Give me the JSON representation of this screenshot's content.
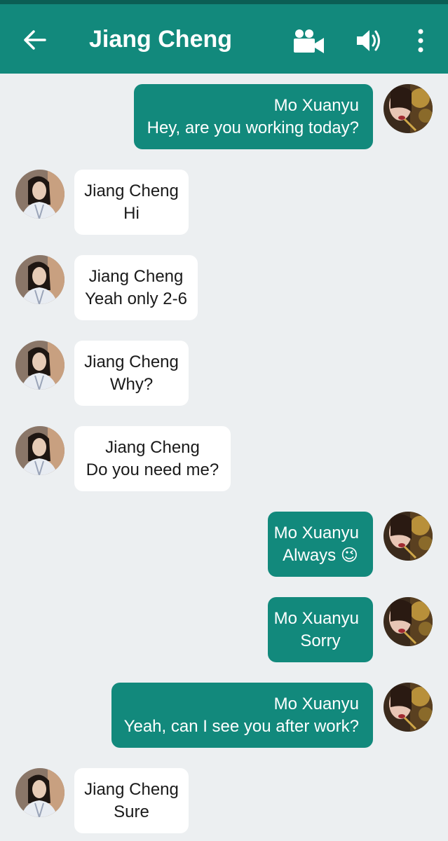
{
  "header": {
    "title": "Jiang Cheng",
    "back_icon": "arrow-left-icon",
    "video_icon": "video-camera-icon",
    "audio_icon": "speaker-icon",
    "more_icon": "more-vert-icon",
    "color": "#12897c"
  },
  "messages": [
    {
      "direction": "out",
      "sender": "Mo Xuanyu",
      "text": "Hey, are you working today?"
    },
    {
      "direction": "in",
      "sender": "Jiang Cheng",
      "text": "Hi"
    },
    {
      "direction": "in",
      "sender": "Jiang Cheng",
      "text": "Yeah only 2-6"
    },
    {
      "direction": "in",
      "sender": "Jiang Cheng",
      "text": "Why?"
    },
    {
      "direction": "in",
      "sender": "Jiang Cheng",
      "text": "Do you need me?"
    },
    {
      "direction": "out",
      "sender": "Mo Xuanyu",
      "text": "Always 😉"
    },
    {
      "direction": "out",
      "sender": "Mo Xuanyu",
      "text": "Sorry"
    },
    {
      "direction": "out",
      "sender": "Mo Xuanyu",
      "text": "Yeah, can I see you after work?"
    },
    {
      "direction": "in",
      "sender": "Jiang Cheng",
      "text": "Sure"
    }
  ]
}
